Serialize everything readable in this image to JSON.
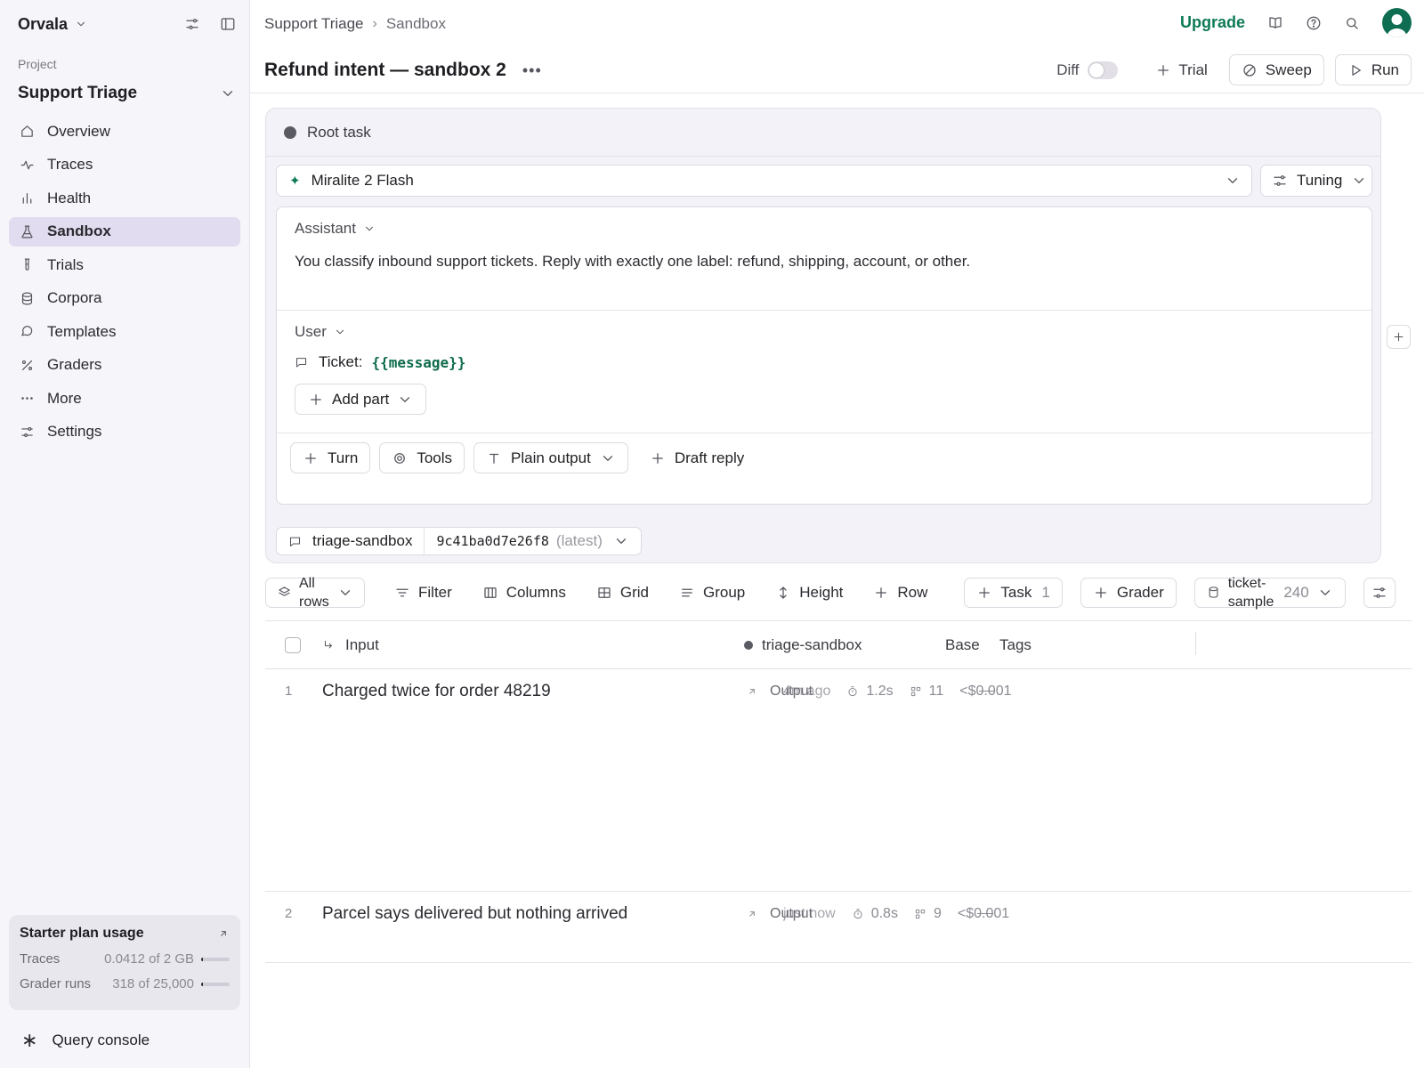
{
  "sidebar": {
    "workspace": "Orvala",
    "project_label": "Project",
    "project_name": "Support Triage",
    "nav": [
      {
        "label": "Overview",
        "icon": "home-icon"
      },
      {
        "label": "Traces",
        "icon": "pulse-icon"
      },
      {
        "label": "Health",
        "icon": "bar-chart-icon"
      },
      {
        "label": "Sandbox",
        "icon": "flask-icon",
        "active": true
      },
      {
        "label": "Trials",
        "icon": "test-tube-icon"
      },
      {
        "label": "Corpora",
        "icon": "database-icon"
      },
      {
        "label": "Templates",
        "icon": "message-icon"
      },
      {
        "label": "Graders",
        "icon": "percent-icon"
      },
      {
        "label": "More",
        "icon": "ellipsis-icon"
      },
      {
        "label": "Settings",
        "icon": "sliders-icon"
      }
    ],
    "usage": {
      "title": "Starter plan usage",
      "rows": [
        {
          "label": "Traces",
          "value": "0.0412 of 2 GB",
          "fraction": 0.0206
        },
        {
          "label": "Grader runs",
          "value": "318 of 25,000",
          "fraction": 0.0127
        }
      ]
    },
    "query_console": "Query console"
  },
  "header": {
    "breadcrumb": [
      "Support Triage",
      "Sandbox"
    ],
    "upgrade": "Upgrade",
    "title": "Refund intent — sandbox 2",
    "diff_label": "Diff",
    "trial_label": "Trial",
    "sweep_label": "Sweep",
    "run_label": "Run"
  },
  "task": {
    "root_label": "Root task",
    "model": "Miralite 2 Flash",
    "tuning": "Tuning",
    "assistant_role": "Assistant",
    "assistant_text": "You classify inbound support tickets. Reply with exactly one label: refund, shipping, account, or other.",
    "user_role": "User",
    "ticket_prefix": "Ticket:",
    "ticket_var": "{{message}}",
    "add_part": "Add part",
    "turn": "Turn",
    "tools": "Tools",
    "output_format": "Plain output",
    "draft_reply": "Draft reply",
    "dataset_name": "triage-sandbox",
    "version_hash": "9c41ba0d7e26f8",
    "version_tag": "(latest)"
  },
  "toolbar": {
    "all_rows": [
      "All",
      "rows"
    ],
    "filter": "Filter",
    "columns": "Columns",
    "grid": "Grid",
    "group": "Group",
    "height": "Height",
    "row": "Row",
    "task": "Task",
    "task_count": "1",
    "grader": "Grader",
    "sample": [
      "ticket-",
      "sample"
    ],
    "sample_count": "240"
  },
  "table": {
    "columns": {
      "input": "Input",
      "sandbox": "triage-sandbox",
      "base": "Base",
      "tags": "Tags"
    },
    "rows": [
      {
        "num": "1",
        "input": "Charged twice for order 48219",
        "output_label": "Output",
        "time_ago": "4m ago",
        "duration": "1.2s",
        "tokens": "11",
        "cost": "<$0.001"
      },
      {
        "num": "2",
        "input": "Parcel says delivered but nothing arrived",
        "output_label": "Output",
        "time_ago": "just now",
        "duration": "0.8s",
        "tokens": "9",
        "cost": "<$0.001"
      }
    ]
  },
  "colors": {
    "accent": "#0e7a55",
    "active_nav": "#e1dcef",
    "sidebar_bg": "#f6f5f9",
    "card_bg": "#f3f2f8"
  }
}
